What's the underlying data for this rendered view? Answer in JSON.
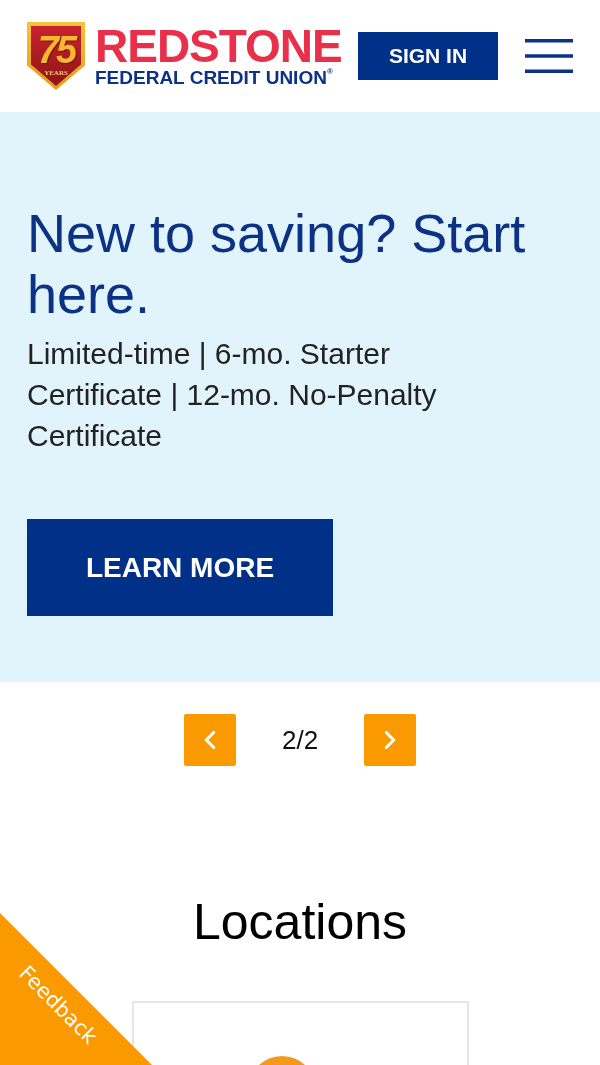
{
  "header": {
    "logo": {
      "badge_number": "75",
      "badge_caption": "YEARS",
      "name": "REDSTONE",
      "tagline": "FEDERAL CREDIT UNION$^{®}$"
    },
    "sign_in_button": "SIGN IN"
  },
  "hero": {
    "heading": "New to saving? Start here.",
    "text": "Limited-time | 6-mo. Starter Certificate | 12-mo. No-Penalty Certificate",
    "button": "LEARN MORE"
  },
  "pager": {
    "counter": "2/2"
  },
  "locations": {
    "heading": "Locations"
  },
  "feedback_tab": "Feedback"
}
